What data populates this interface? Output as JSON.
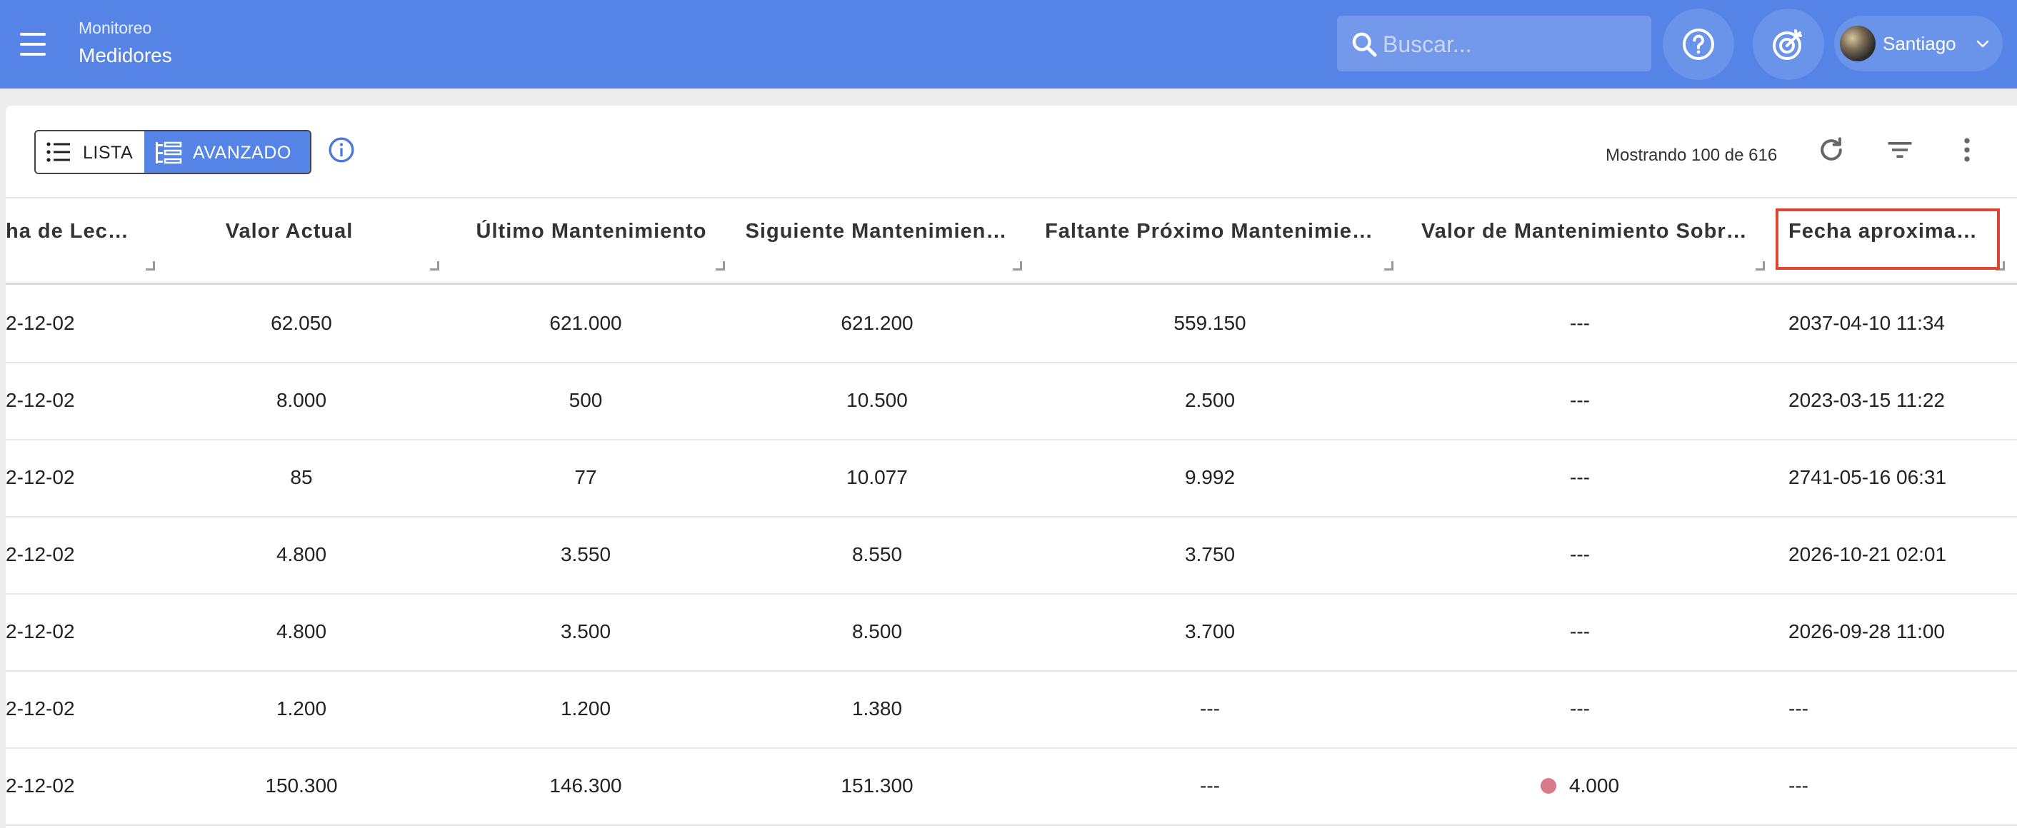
{
  "header": {
    "breadcrumb_parent": "Monitoreo",
    "page_title": "Medidores",
    "search_placeholder": "Buscar...",
    "user_name": "Santiago",
    "brand_color": "#5584e6"
  },
  "toolbar": {
    "view_list_label": "LISTA",
    "view_advanced_label": "AVANZADO",
    "selected_view": "AVANZADO",
    "record_count_text": "Mostrando 100 de 616",
    "icons": [
      "info-icon",
      "refresh-icon",
      "filter-icon",
      "more-vert-icon"
    ]
  },
  "table": {
    "columns": [
      "ha de Lect…",
      "Valor Actual",
      "Último Mantenimiento",
      "Siguiente Mantenimien…",
      "Faltante Próximo Mantenimie…",
      "Valor de Mantenimiento Sobre…",
      "Fecha aproximad…"
    ],
    "highlighted_column": "Fecha aproximad…",
    "rows": [
      [
        "2-12-02",
        "62.050",
        "621.000",
        "621.200",
        "559.150",
        "---",
        "2037-04-10 11:34"
      ],
      [
        "2-12-02",
        "8.000",
        "500",
        "10.500",
        "2.500",
        "---",
        "2023-03-15 11:22"
      ],
      [
        "2-12-02",
        "85",
        "77",
        "10.077",
        "9.992",
        "---",
        "2741-05-16 06:31"
      ],
      [
        "2-12-02",
        "4.800",
        "3.550",
        "8.550",
        "3.750",
        "---",
        "2026-10-21 02:01"
      ],
      [
        "2-12-02",
        "4.800",
        "3.500",
        "8.500",
        "3.700",
        "---",
        "2026-09-28 11:00"
      ],
      [
        "2-12-02",
        "1.200",
        "1.200",
        "1.380",
        "---",
        "---",
        "---"
      ],
      [
        "2-12-02",
        "150.300",
        "146.300",
        "151.300",
        "---",
        "4.000",
        "---"
      ]
    ],
    "status_dot_color": "#d97a8a"
  }
}
